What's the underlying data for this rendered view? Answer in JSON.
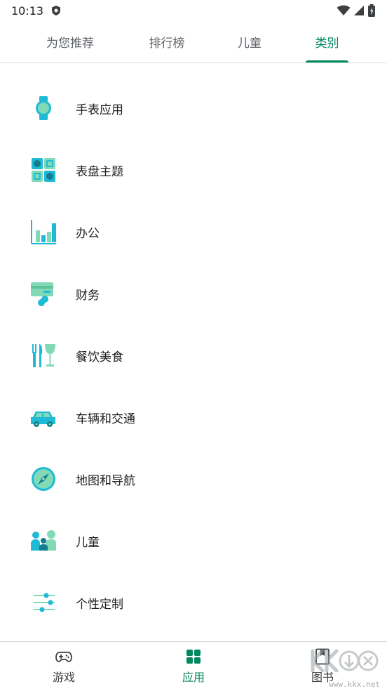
{
  "status_bar": {
    "time": "10:13",
    "icons": [
      "shield-icon",
      "wifi-icon",
      "signal-icon",
      "battery-icon"
    ]
  },
  "tabs": [
    {
      "label": "为您推荐",
      "active": false
    },
    {
      "label": "排行榜",
      "active": false
    },
    {
      "label": "儿童",
      "active": false
    },
    {
      "label": "类别",
      "active": true
    }
  ],
  "categories": [
    {
      "label": "手表应用",
      "icon": "watch-icon"
    },
    {
      "label": "表盘主题",
      "icon": "watch-face-icon"
    },
    {
      "label": "办公",
      "icon": "office-chart-icon"
    },
    {
      "label": "财务",
      "icon": "finance-card-icon"
    },
    {
      "label": "餐饮美食",
      "icon": "food-drink-icon"
    },
    {
      "label": "车辆和交通",
      "icon": "car-icon"
    },
    {
      "label": "地图和导航",
      "icon": "compass-icon"
    },
    {
      "label": "儿童",
      "icon": "kids-icon"
    },
    {
      "label": "个性定制",
      "icon": "customize-sliders-icon"
    }
  ],
  "bottom_nav": [
    {
      "label": "游戏",
      "icon": "gamepad-icon",
      "active": false
    },
    {
      "label": "应用",
      "icon": "apps-grid-icon",
      "active": true
    },
    {
      "label": "图书",
      "icon": "book-icon",
      "active": false
    }
  ],
  "watermark": {
    "text": "www.kkx.net",
    "logo": "kkx-download-logo"
  },
  "colors": {
    "accent": "#01875f",
    "icon_teal": "#1fbad6",
    "icon_mint": "#81d9b6",
    "divider": "#dadce0"
  }
}
